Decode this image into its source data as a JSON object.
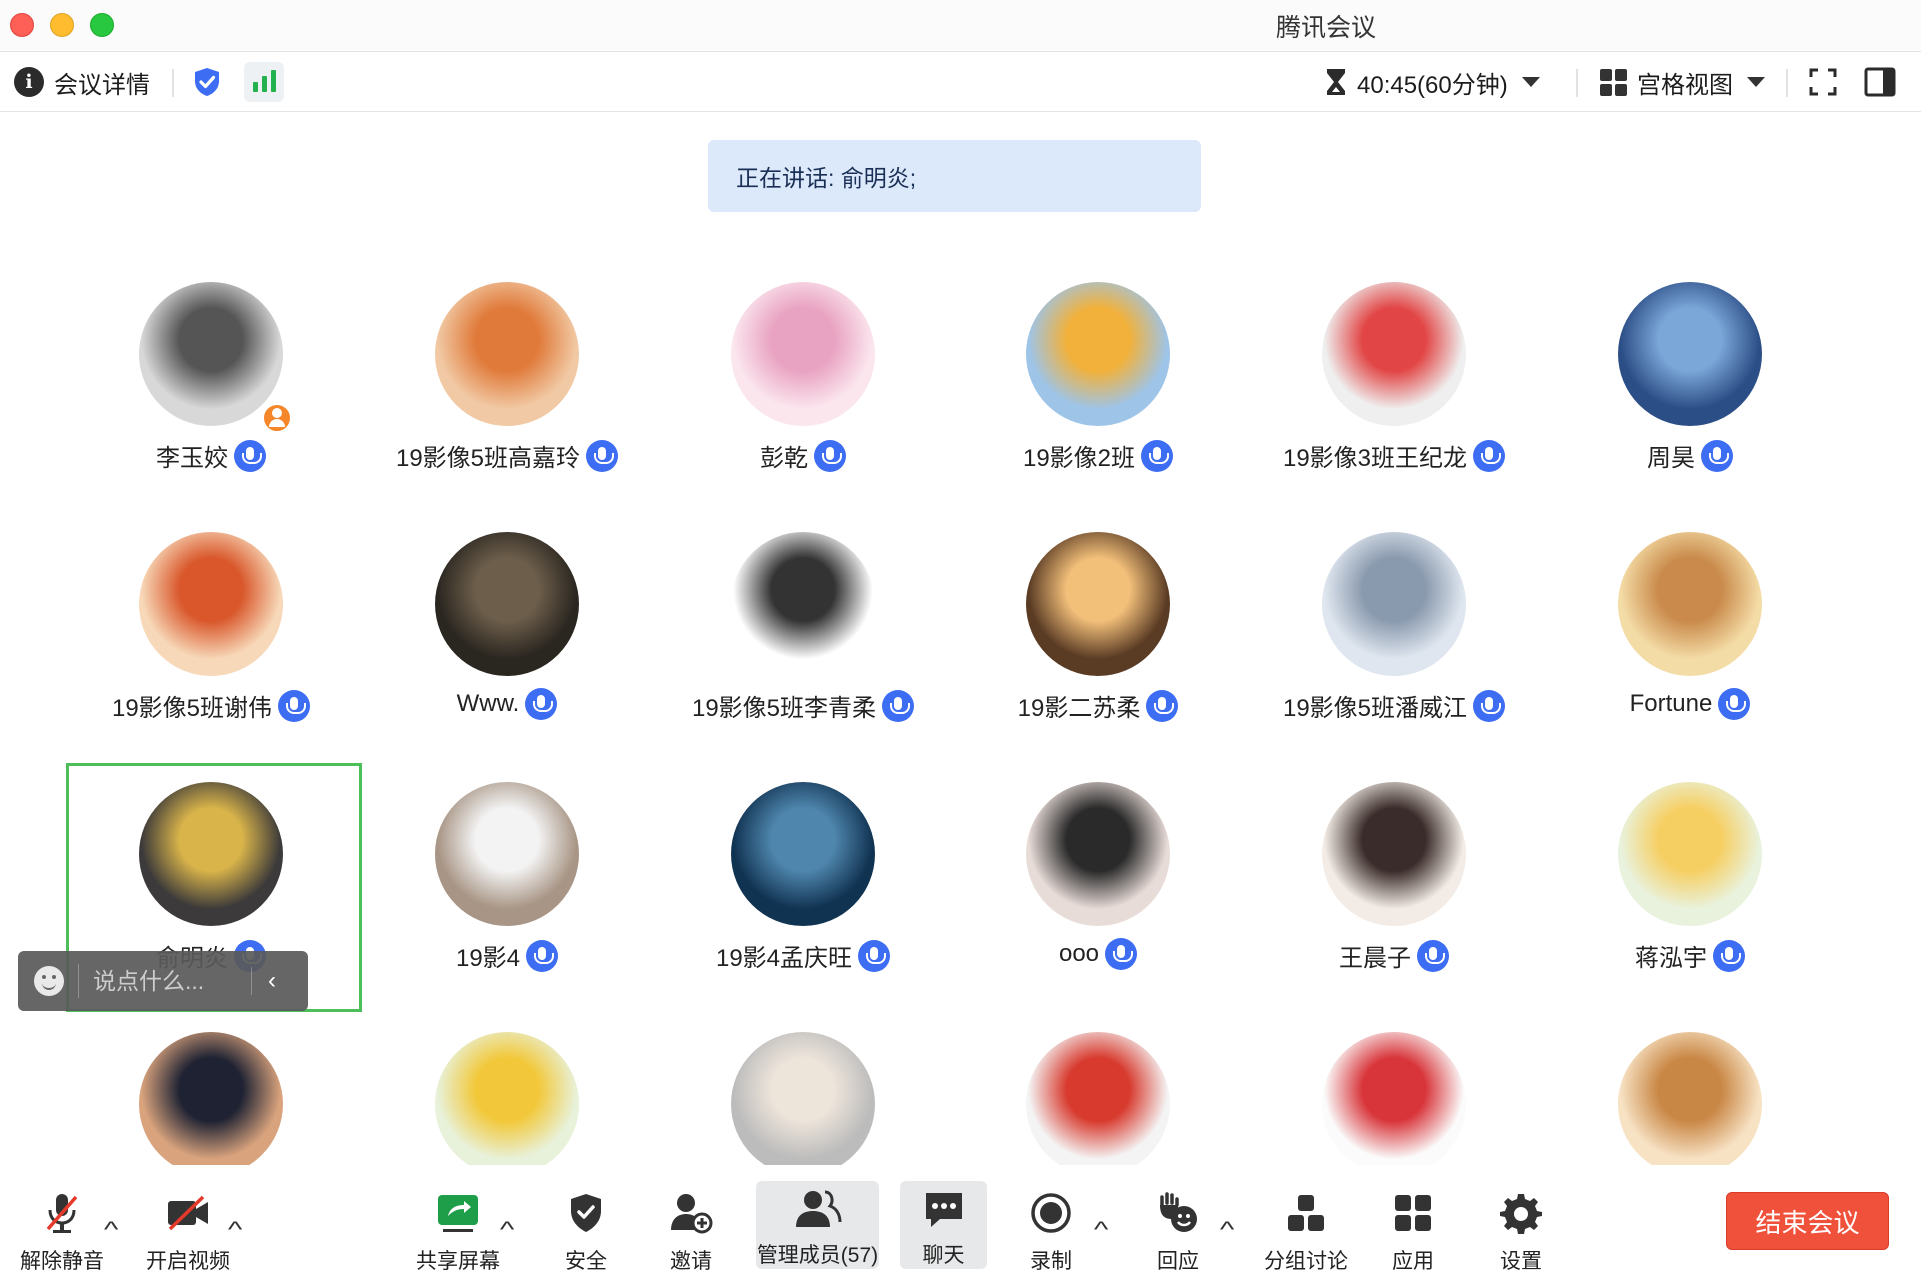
{
  "window": {
    "title": "腾讯会议"
  },
  "toolbar": {
    "meeting_details": "会议详情",
    "timer": "40:45(60分钟)",
    "view_mode": "宫格视图"
  },
  "speaking_banner": "正在讲话: 俞明炎;",
  "participants": [
    {
      "name": "李玉姣",
      "host": true
    },
    {
      "name": "19影像5班高嘉玲"
    },
    {
      "name": "彭乾"
    },
    {
      "name": "19影像2班"
    },
    {
      "name": "19影像3班王纪龙"
    },
    {
      "name": "周昊"
    },
    {
      "name": "19影像5班谢伟"
    },
    {
      "name": "Www."
    },
    {
      "name": "19影像5班李青柔"
    },
    {
      "name": "19影二苏柔"
    },
    {
      "name": "19影像5班潘威江"
    },
    {
      "name": "Fortune"
    },
    {
      "name": "俞明炎",
      "speaking": true
    },
    {
      "name": "19影4"
    },
    {
      "name": "19影4孟庆旺"
    },
    {
      "name": "ooo"
    },
    {
      "name": "王晨子"
    },
    {
      "name": "蒋泓宇"
    },
    {
      "name": ""
    },
    {
      "name": ""
    },
    {
      "name": ""
    },
    {
      "name": ""
    },
    {
      "name": ""
    },
    {
      "name": ""
    }
  ],
  "chat": {
    "placeholder": "说点什么..."
  },
  "controls": {
    "unmute": "解除静音",
    "start_video": "开启视频",
    "share_screen": "共享屏幕",
    "security": "安全",
    "invite": "邀请",
    "manage_members": "管理成员(57)",
    "chat": "聊天",
    "record": "录制",
    "reactions": "回应",
    "breakout": "分组讨论",
    "apps": "应用",
    "settings": "设置",
    "end_meeting": "结束会议"
  },
  "colors": {
    "accent_blue": "#3d6df2",
    "end_button": "#f0513b",
    "speaking_frame": "#4cbf5a",
    "banner_bg": "#dce9fb"
  }
}
